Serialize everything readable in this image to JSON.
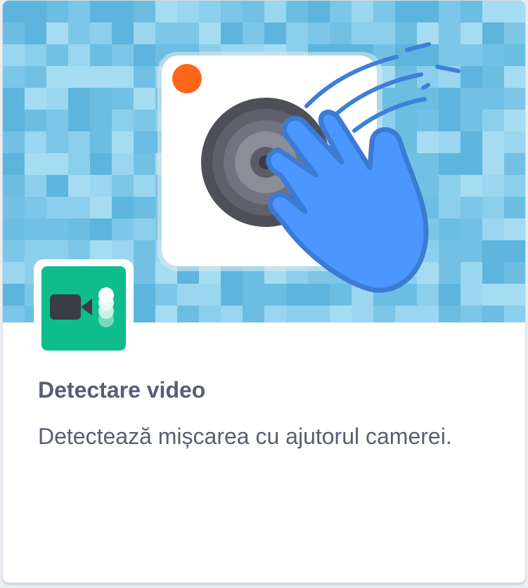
{
  "extension": {
    "title": "Detectare video",
    "description": "Detectează mișcarea cu ajutorul camerei.",
    "hero_icon": "camera-hand-wave-illustration",
    "badge_icon": "video-sensing-icon"
  },
  "colors": {
    "hero_background": "#74c0e3",
    "badge_background": "#0fbd8c",
    "hand": "#4c97ff",
    "text": "#575e75",
    "record_dot": "#ff661a"
  }
}
